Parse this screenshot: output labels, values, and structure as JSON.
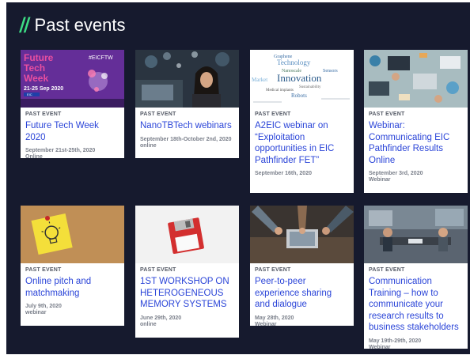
{
  "heading": {
    "slashes": "//",
    "title": "Past events"
  },
  "colors": {
    "background": "#161a2e",
    "accent": "#3ddc84",
    "link": "#2b45d8",
    "tag": "#555a66"
  },
  "thumb0": {
    "line1": "Future",
    "line2": "Tech",
    "line3": "Week",
    "dates": "21-25 Sep 2020",
    "hashtag": "#EICFTW",
    "badge": "EIC"
  },
  "cloud": {
    "w1": "Graphene",
    "w2": "Technology",
    "w3": "Nanoscale",
    "w4": "Sensors",
    "w5": "Innovation",
    "w6": "Market",
    "w7": "Robots",
    "w8": "Medical implants",
    "w9": "Sustainability"
  },
  "events": [
    {
      "tag": "PAST EVENT",
      "title": "Future Tech Week 2020",
      "date": "September 21st-25th, 2020",
      "location": "Online"
    },
    {
      "tag": "PAST EVENT",
      "title": "NanoTBTech webinars",
      "date": "September 18th-October 2nd, 2020",
      "location": "online"
    },
    {
      "tag": "PAST EVENT",
      "title": "A2EIC webinar on “Exploitation opportunities in EIC Pathfinder FET”",
      "date": "September 16th, 2020",
      "location": ""
    },
    {
      "tag": "PAST EVENT",
      "title": "Webinar: Communicating EIC Pathfinder Results Online",
      "date": "September 3rd, 2020",
      "location": "Webinar"
    },
    {
      "tag": "PAST EVENT",
      "title": "Online pitch and matchmaking",
      "date": "July 9th, 2020",
      "location": "webinar"
    },
    {
      "tag": "PAST EVENT",
      "title": "1ST WORKSHOP ON HETEROGENEOUS MEMORY SYSTEMS",
      "date": "June 29th, 2020",
      "location": "online"
    },
    {
      "tag": "PAST EVENT",
      "title": "Peer-to-peer experience sharing and dialogue",
      "date": "May 28th, 2020",
      "location": "Webinar"
    },
    {
      "tag": "PAST EVENT",
      "title": "Communication Training – how to communicate your research results to business stakeholders",
      "date": "May 19th-29th, 2020",
      "location": "Webinar"
    }
  ]
}
